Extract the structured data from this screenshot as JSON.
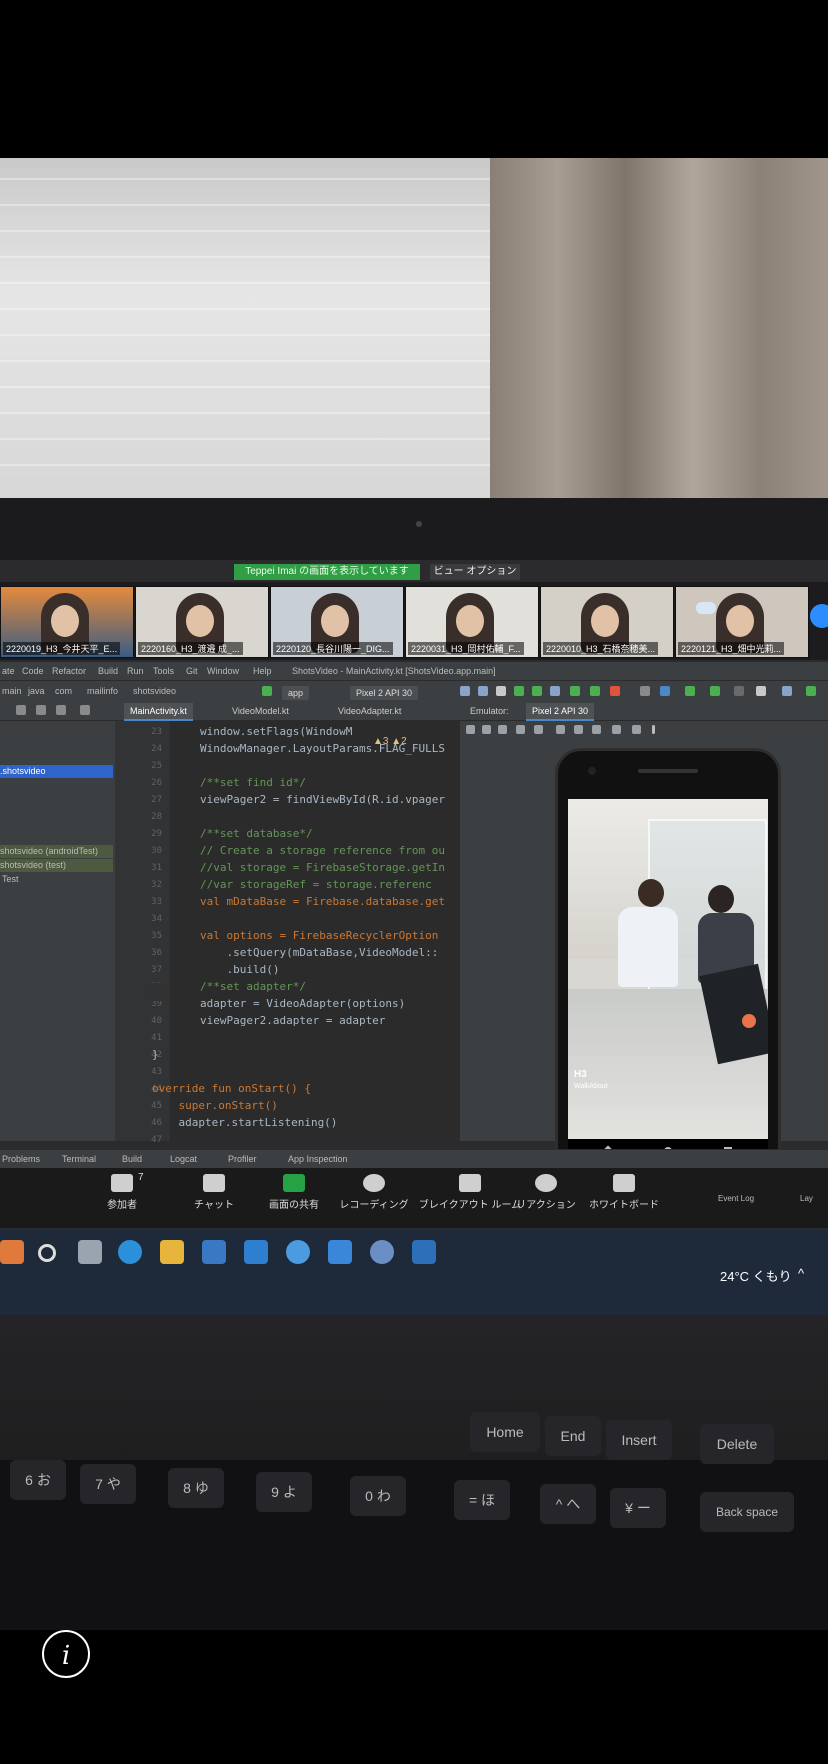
{
  "zoom": {
    "share_banner": "Teppei Imai の画面を表示しています",
    "view_options": "ビュー オプション ∨",
    "participants": [
      {
        "label": "2220019_H3_今井天平_E..."
      },
      {
        "label": "2220160_H3_渡邉 成_..."
      },
      {
        "label": "2220120_長谷川陽一_DIG..."
      },
      {
        "label": "2220031_H3_岡村佑輔_F..."
      },
      {
        "label": "2220010_H3_石橋奈穂美..."
      },
      {
        "label": "2220121_H3_畑中光莉..."
      }
    ],
    "controls": [
      {
        "label": "参加者",
        "badge": "7",
        "icon": "participants-icon"
      },
      {
        "label": "チャット",
        "badge": "",
        "icon": "chat-icon"
      },
      {
        "label": "画面の共有",
        "badge": "",
        "icon": "share-screen-icon"
      },
      {
        "label": "レコーディング",
        "badge": "",
        "icon": "record-icon"
      },
      {
        "label": "ブレイクアウト ルーム",
        "badge": "",
        "icon": "breakout-icon"
      },
      {
        "label": "リアクション",
        "badge": "",
        "icon": "reaction-icon"
      },
      {
        "label": "ホワイトボード",
        "badge": "",
        "icon": "whiteboard-icon"
      }
    ]
  },
  "ide": {
    "menu": [
      "ate",
      "Code",
      "Refactor",
      "Build",
      "Run",
      "Tools",
      "Git",
      "Window",
      "Help"
    ],
    "window_title": "ShotsVideo - MainActivity.kt [ShotsVideo.app.main]",
    "breadcrumbs": [
      "main",
      "java",
      "com",
      "mailinfo",
      "shotsvideo"
    ],
    "run_config": "app",
    "device": "Pixel 2 API 30",
    "tabs": [
      "MainActivity.kt",
      "VideoModel.kt",
      "VideoAdapter.kt"
    ],
    "emulator_label": "Emulator:",
    "emulator_tab": "Pixel 2 API 30",
    "project_rows": [
      ".shotsvideo",
      "shotsvideo (androidTest)",
      "shotsvideo (test)",
      "Test"
    ],
    "line_numbers": [
      "23",
      "24",
      "25",
      "26",
      "27",
      "28",
      "29",
      "30",
      "31",
      "32",
      "33",
      "34",
      "35",
      "36",
      "37",
      "38",
      "39",
      "40",
      "41",
      "42",
      "43",
      "44",
      "45",
      "46",
      "47"
    ],
    "code_lines": [
      {
        "text": "window.setFlags(WindowM"
      },
      {
        "text": "WindowManager.LayoutParams.FLAG_FULLS"
      },
      {
        "text": ""
      },
      {
        "text": "/**set find id*/"
      },
      {
        "text": "viewPager2 = findViewById(R.id.vpager"
      },
      {
        "text": ""
      },
      {
        "text": "/**set database*/"
      },
      {
        "text": "// Create a storage reference from ou"
      },
      {
        "text": "//val storage = FirebaseStorage.getIn"
      },
      {
        "text": "//var storageRef = storage.referenc"
      },
      {
        "text": "val mDataBase = Firebase.database.get"
      },
      {
        "text": ""
      },
      {
        "text": "val options = FirebaseRecyclerOption"
      },
      {
        "text": "    .setQuery(mDataBase,VideoModel::"
      },
      {
        "text": "    .build()"
      },
      {
        "text": "/**set adapter*/"
      },
      {
        "text": "adapter = VideoAdapter(options)"
      },
      {
        "text": "viewPager2.adapter = adapter"
      },
      {
        "text": ""
      },
      {
        "text": "}"
      },
      {
        "text": ""
      },
      {
        "text": "override fun onStart() {"
      },
      {
        "text": "    super.onStart()"
      },
      {
        "text": "    adapter.startListening()"
      }
    ],
    "warnings": "▲3 ▲2",
    "bottom_tools": [
      "Problems",
      "Terminal",
      "Build",
      "Logcat",
      "Profiler",
      "App Inspection"
    ],
    "event_log": "Event Log",
    "layout_label": "Lay"
  },
  "phone": {
    "badge": "H3",
    "sub": "WalkAbout"
  },
  "taskbar": {
    "weather": "24°C くもり",
    "chevron": "^"
  },
  "keyboard": {
    "row1": [
      "6 お",
      "7 や",
      "8 ゆ",
      "9 よ",
      "0 わ",
      "= ほ",
      "^ へ",
      "¥ ー"
    ],
    "row0": [
      "Home",
      "End",
      "Insert",
      "Delete"
    ],
    "back": "Back space"
  },
  "info": {
    "glyph": "i"
  },
  "colors": {
    "accent": "#2d8cff",
    "share_green": "#2f9e44",
    "ide_bg": "#2b2b2b"
  }
}
